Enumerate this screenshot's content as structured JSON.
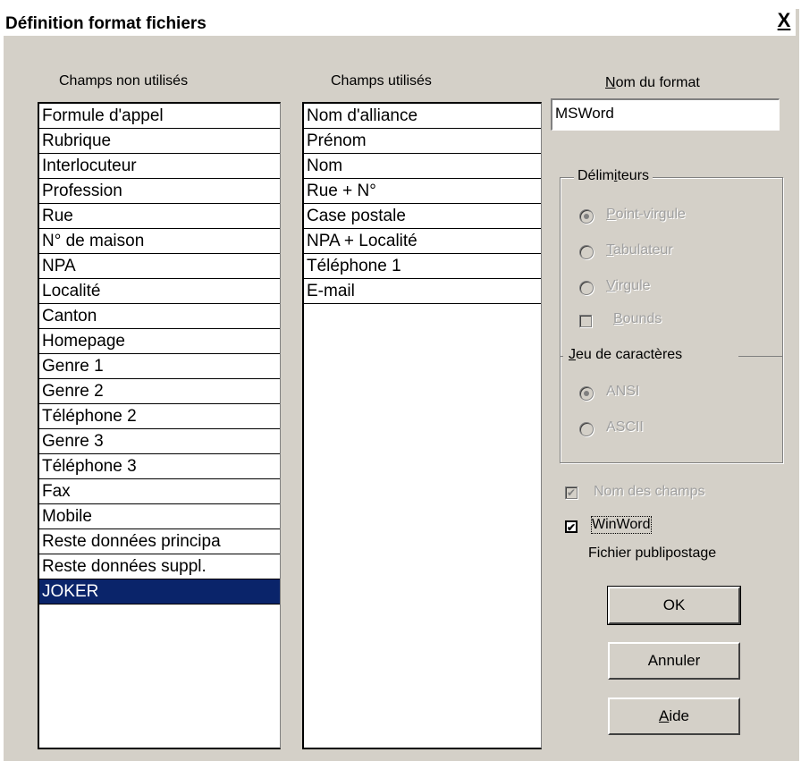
{
  "window": {
    "title": "Définition format fichiers",
    "close_glyph": "X"
  },
  "unused": {
    "header": "Champs non utilisés",
    "items": [
      "Formule d'appel",
      "Rubrique",
      "Interlocuteur",
      "Profession",
      "Rue",
      "N° de maison",
      "NPA",
      "Localité",
      "Canton",
      "Homepage",
      "Genre 1",
      "Genre 2",
      "Téléphone 2",
      "Genre 3",
      "Téléphone 3",
      "Fax",
      "Mobile",
      "Reste données principa",
      "Reste données suppl.",
      "JOKER"
    ],
    "selected": "JOKER"
  },
  "used": {
    "header": "Champs utilisés",
    "items": [
      "Nom d'alliance",
      "Prénom",
      "Nom",
      "Rue + N°",
      "Case postale",
      "NPA + Localité",
      "Téléphone 1",
      "E-mail"
    ]
  },
  "format": {
    "label_first": "N",
    "label_rest": "om du format",
    "value": "MSWord"
  },
  "delimiters": {
    "label_a": "Délim",
    "label_u": "i",
    "label_b": "teurs",
    "options": [
      {
        "u": "P",
        "rest": "oint-virgule",
        "checked": true
      },
      {
        "u": "T",
        "rest": "abulateur",
        "checked": false
      },
      {
        "u": "V",
        "rest": "irgule",
        "checked": false
      }
    ],
    "bounds": {
      "u": "B",
      "rest": "ounds",
      "checked": false
    }
  },
  "charset": {
    "label_u": "J",
    "label_rest": "eu de caractères",
    "options": [
      {
        "label": "ANSI",
        "checked": true
      },
      {
        "label": "ASCII",
        "checked": false
      }
    ]
  },
  "fieldnames": {
    "label": "Nom des champs",
    "checked": true
  },
  "winword": {
    "label": "WinWord",
    "sublabel": "Fichier publipostage",
    "checked": true
  },
  "buttons": {
    "ok": "OK",
    "cancel": "Annuler",
    "help_u": "A",
    "help_rest": "ide"
  }
}
